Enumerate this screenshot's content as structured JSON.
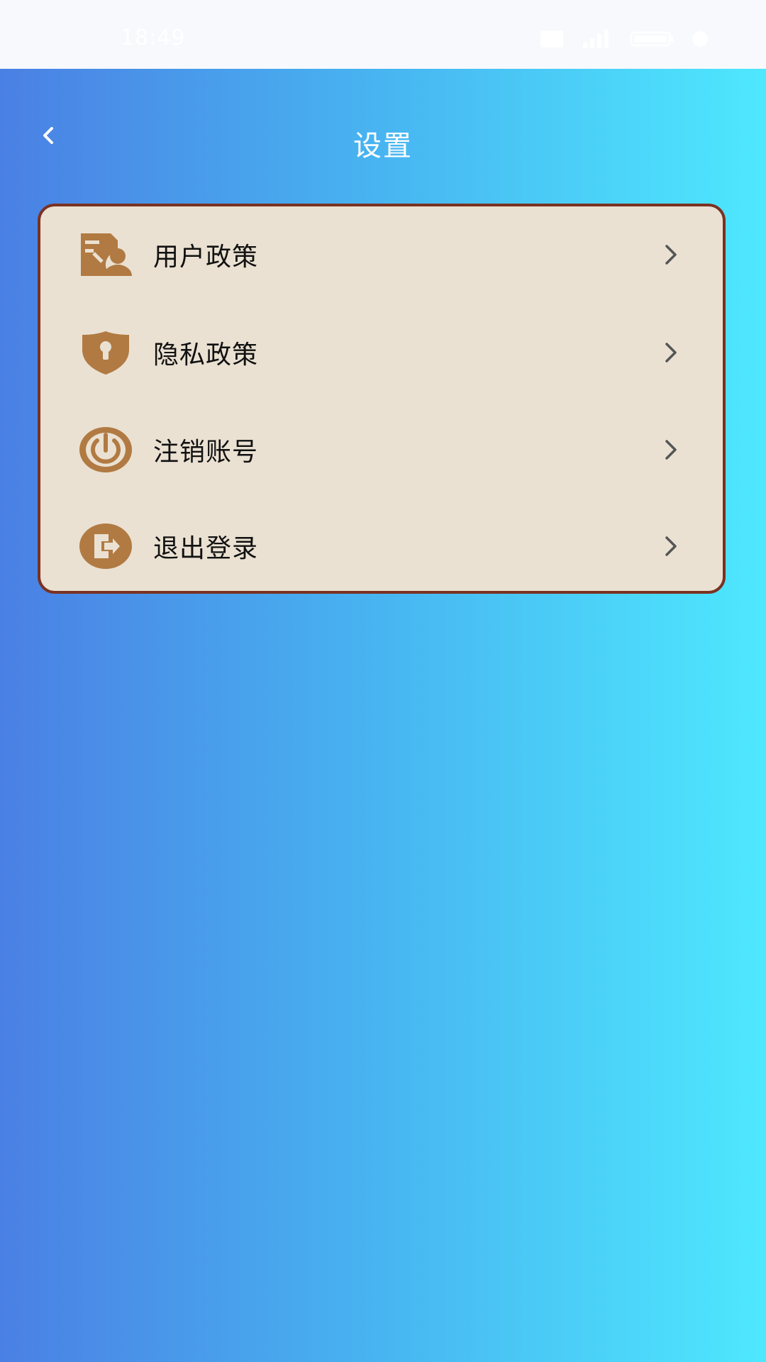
{
  "status_bar": {
    "time": "18:49"
  },
  "header": {
    "title": "设置"
  },
  "menu": {
    "items": [
      {
        "label": "用户政策",
        "icon": "user-policy-icon"
      },
      {
        "label": "隐私政策",
        "icon": "privacy-shield-icon"
      },
      {
        "label": "注销账号",
        "icon": "power-icon"
      },
      {
        "label": "退出登录",
        "icon": "logout-icon"
      }
    ]
  },
  "colors": {
    "gradient_start": "#4a80e4",
    "gradient_end": "#4ee8fe",
    "card_background": "#eae1d2",
    "card_border": "#7a3222",
    "icon_color": "#b17a42"
  }
}
